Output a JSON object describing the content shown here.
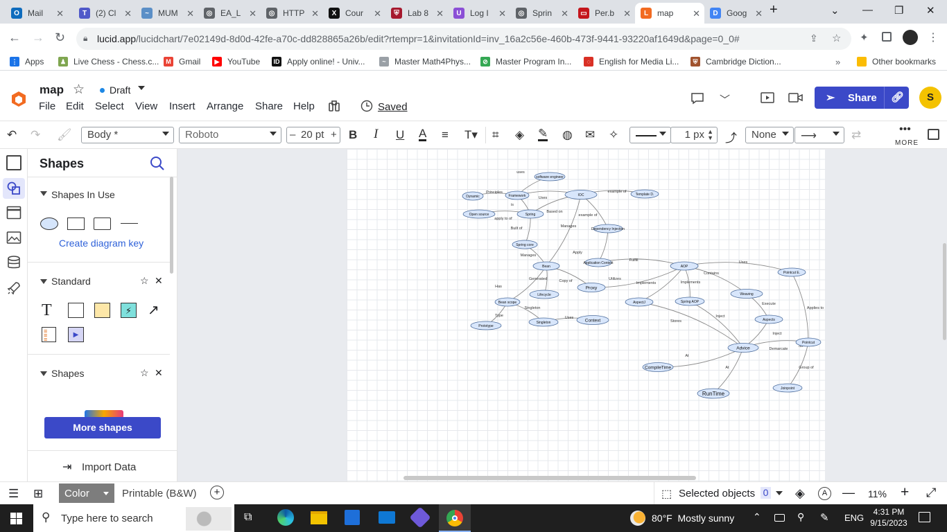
{
  "tabs": [
    {
      "title": "Mail",
      "fav": "#0f6cbd",
      "glyph": "O"
    },
    {
      "title": "(2) Cl",
      "fav": "#5059c9",
      "glyph": "T"
    },
    {
      "title": "MUM",
      "fav": "#5b8fc7",
      "glyph": "~"
    },
    {
      "title": "EA_L",
      "fav": "#5f6368",
      "glyph": "◎"
    },
    {
      "title": "HTTP",
      "fav": "#5f6368",
      "glyph": "◎"
    },
    {
      "title": "Cour",
      "fav": "#111",
      "glyph": "X"
    },
    {
      "title": "Lab 8",
      "fav": "#a6192e",
      "glyph": "⛨"
    },
    {
      "title": "Log I",
      "fav": "#8b4fd6",
      "glyph": "U"
    },
    {
      "title": "Sprin",
      "fav": "#5f6368",
      "glyph": "◎"
    },
    {
      "title": "Per.b",
      "fav": "#c4161c",
      "glyph": "▭"
    },
    {
      "title": "map",
      "fav": "#f26b21",
      "glyph": "L"
    },
    {
      "title": "Goog",
      "fav": "#4285f4",
      "glyph": "D"
    }
  ],
  "active_tab_index": 10,
  "url": {
    "host": "lucid.app",
    "path": "/lucidchart/7e02149d-8d0d-42fe-a70c-dd828865a26b/edit?rtempr=1&invitationId=inv_16a2c56e-460b-473f-9441-93220af1649d&page=0_0#"
  },
  "bookmarks": [
    {
      "label": "Apps",
      "color": "#1a73e8",
      "glyph": "⋮"
    },
    {
      "label": "Live Chess - Chess.c...",
      "color": "#7fa650",
      "glyph": "♟"
    },
    {
      "label": "Gmail",
      "color": "#ea4335",
      "glyph": "M"
    },
    {
      "label": "YouTube",
      "color": "#ff0000",
      "glyph": "▶"
    },
    {
      "label": "Apply online! - Univ...",
      "color": "#111",
      "glyph": "ID"
    },
    {
      "label": "Master Math4Phys...",
      "color": "#9aa0a6",
      "glyph": "~"
    },
    {
      "label": "Master Program In...",
      "color": "#34a853",
      "glyph": "⊘"
    },
    {
      "label": "English for Media Li...",
      "color": "#d93025",
      "glyph": "◌"
    },
    {
      "label": "Cambridge Diction...",
      "color": "#a0522d",
      "glyph": "⛨"
    }
  ],
  "other_bookmarks": "Other bookmarks",
  "doc": {
    "name": "map",
    "status": "Draft",
    "saved": "Saved"
  },
  "menus": [
    "File",
    "Edit",
    "Select",
    "View",
    "Insert",
    "Arrange",
    "Share",
    "Help"
  ],
  "share_label": "Share",
  "avatar_letter": "S",
  "toolbar": {
    "style": "Body *",
    "font": "Roboto",
    "size": "20 pt",
    "line_width": "1 px",
    "arrow_start": "None",
    "more": "MORE"
  },
  "shapes_panel": {
    "title": "Shapes",
    "in_use": "Shapes In Use",
    "diagram_key": "Create diagram key",
    "standard": "Standard",
    "shapes": "Shapes",
    "more_shapes": "More shapes",
    "import_data": "Import Data"
  },
  "bottom": {
    "color": "Color",
    "printable": "Printable (B&W)",
    "selected": "Selected objects",
    "selected_count": "0",
    "zoom": "11%"
  },
  "taskbar": {
    "search": "Type here to search",
    "weather": "80°F  Mostly sunny",
    "lang": "ENG",
    "time": "4:31 PM",
    "date": "9/15/2023"
  },
  "diagram": {
    "nodes": [
      {
        "id": "sw",
        "label": "software engineer"
      },
      {
        "id": "dyn",
        "label": "Dynamic"
      },
      {
        "id": "fw",
        "label": "Framework"
      },
      {
        "id": "ioc",
        "label": "IOC"
      },
      {
        "id": "tpl",
        "label": "Template D."
      },
      {
        "id": "os",
        "label": "Open source"
      },
      {
        "id": "spring",
        "label": "Spring"
      },
      {
        "id": "dep",
        "label": "Dependency Injection"
      },
      {
        "id": "sc",
        "label": "Spring core"
      },
      {
        "id": "appctx",
        "label": "Application Context"
      },
      {
        "id": "bean",
        "label": "Bean"
      },
      {
        "id": "aop",
        "label": "AOP"
      },
      {
        "id": "pe",
        "label": "Pointcut E."
      },
      {
        "id": "proxy",
        "label": "Proxy"
      },
      {
        "id": "lifecycle",
        "label": "Lifecycle"
      },
      {
        "id": "weaving",
        "label": "Weaving"
      },
      {
        "id": "aspectj",
        "label": "AspectJ"
      },
      {
        "id": "saop",
        "label": "Spring AOP"
      },
      {
        "id": "bscope",
        "label": "Bean scope"
      },
      {
        "id": "aspects",
        "label": "Aspects"
      },
      {
        "id": "proto",
        "label": "Prototype"
      },
      {
        "id": "single",
        "label": "Singleton"
      },
      {
        "id": "ctx",
        "label": "Context"
      },
      {
        "id": "pointcut",
        "label": "Pointcut"
      },
      {
        "id": "advice",
        "label": "Advice"
      },
      {
        "id": "ct",
        "label": "CompileTime"
      },
      {
        "id": "jp",
        "label": "Joinpoint"
      },
      {
        "id": "rt",
        "label": "RunTime"
      }
    ],
    "edge_labels": [
      "uses",
      "Principles",
      "Uses",
      "example of",
      "is",
      "Based on",
      "apply to of",
      "example of",
      "Manages",
      "Built of",
      "Manages",
      "Apply",
      "Fulfill",
      "Uses",
      "Contains",
      "Implements",
      "Implements",
      "Utilizes",
      "Copy of",
      "Generated",
      "Has",
      "Singleton",
      "Type",
      "Uses",
      "Execute",
      "Stores",
      "Inject",
      "Inject",
      "Its",
      "Demarcate",
      "Applies to",
      "Group of",
      "At",
      "At"
    ]
  }
}
